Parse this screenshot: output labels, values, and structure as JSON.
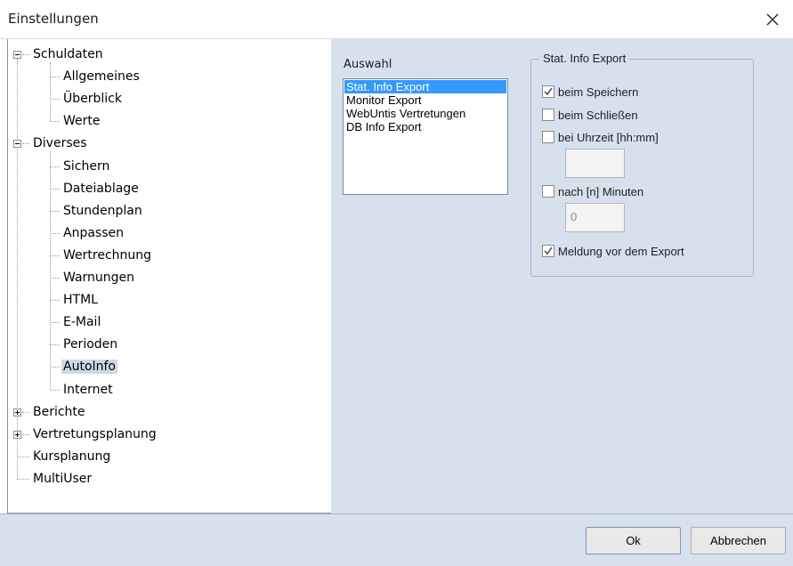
{
  "window": {
    "title": "Einstellungen"
  },
  "tree": {
    "items": [
      {
        "label": "Schuldaten",
        "level": 0,
        "expander": "minus",
        "selected": false
      },
      {
        "label": "Allgemeines",
        "level": 1,
        "selected": false
      },
      {
        "label": "Überblick",
        "level": 1,
        "selected": false
      },
      {
        "label": "Werte",
        "level": 1,
        "selected": false
      },
      {
        "label": "Diverses",
        "level": 0,
        "expander": "minus",
        "selected": false
      },
      {
        "label": "Sichern",
        "level": 1,
        "selected": false
      },
      {
        "label": "Dateiablage",
        "level": 1,
        "selected": false
      },
      {
        "label": "Stundenplan",
        "level": 1,
        "selected": false
      },
      {
        "label": "Anpassen",
        "level": 1,
        "selected": false
      },
      {
        "label": "Wertrechnung",
        "level": 1,
        "selected": false
      },
      {
        "label": "Warnungen",
        "level": 1,
        "selected": false
      },
      {
        "label": "HTML",
        "level": 1,
        "selected": false
      },
      {
        "label": "E-Mail",
        "level": 1,
        "selected": false
      },
      {
        "label": "Perioden",
        "level": 1,
        "selected": false
      },
      {
        "label": "AutoInfo",
        "level": 1,
        "selected": true
      },
      {
        "label": "Internet",
        "level": 1,
        "selected": false
      },
      {
        "label": "Berichte",
        "level": 0,
        "expander": "plus",
        "selected": false
      },
      {
        "label": "Vertretungsplanung",
        "level": 0,
        "expander": "plus",
        "selected": false
      },
      {
        "label": "Kursplanung",
        "level": 0,
        "selected": false
      },
      {
        "label": "MultiUser",
        "level": 0,
        "selected": false
      }
    ]
  },
  "auswahl": {
    "label": "Auswahl",
    "items": [
      "Stat. Info Export",
      "Monitor Export",
      "WebUntis Vertretungen",
      "DB Info Export"
    ],
    "selected_index": 0
  },
  "export_group": {
    "legend": "Stat. Info Export",
    "beim_speichern": {
      "label": "beim Speichern",
      "checked": true
    },
    "beim_schliessen": {
      "label": "beim Schließen",
      "checked": false
    },
    "bei_uhrzeit": {
      "label": "bei Uhrzeit [hh:mm]",
      "checked": false,
      "value": ""
    },
    "nach_minuten": {
      "label": "nach [n] Minuten",
      "checked": false,
      "value": "0"
    },
    "meldung": {
      "label": "Meldung vor dem Export",
      "checked": true
    }
  },
  "buttons": {
    "ok": "Ok",
    "cancel": "Abbrechen"
  },
  "colors": {
    "panel_bg": "#d7e1ee",
    "selection": "#3399ff",
    "tree_selection": "#cdd9e8"
  }
}
